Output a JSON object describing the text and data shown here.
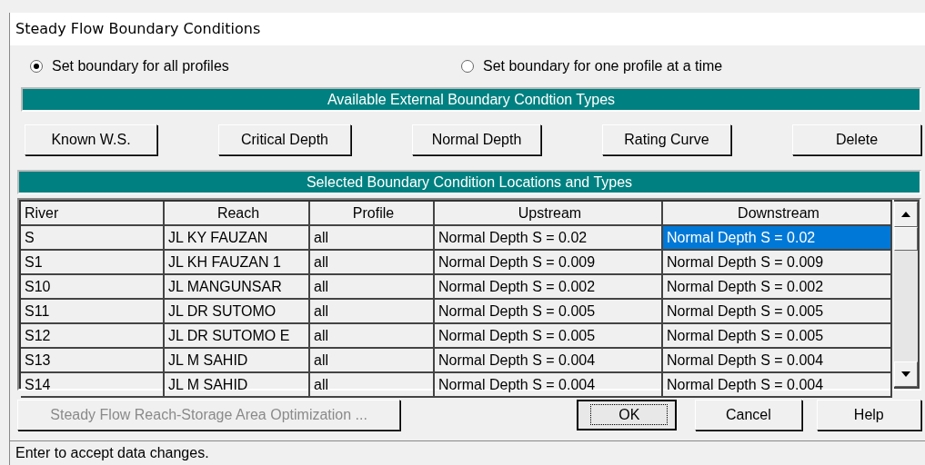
{
  "window": {
    "title": "Steady Flow Boundary Conditions"
  },
  "mode_options": [
    {
      "label": "Set boundary for all profiles",
      "selected": true
    },
    {
      "label": "Set boundary for one profile at a time",
      "selected": false
    }
  ],
  "types_header": "Available External Boundary Condtion Types",
  "type_buttons": [
    "Known W.S.",
    "Critical Depth",
    "Normal Depth",
    "Rating Curve",
    "Delete"
  ],
  "locations_header": "Selected Boundary Condition Locations and Types",
  "table": {
    "columns": [
      "River",
      "Reach",
      "Profile",
      "Upstream",
      "Downstream"
    ],
    "rows": [
      {
        "cells": [
          {
            "text": "S",
            "selected": false
          },
          {
            "text": "JL KY FAUZAN",
            "selected": false
          },
          {
            "text": "all",
            "selected": false
          },
          {
            "text": "Normal Depth S = 0.02",
            "selected": false
          },
          {
            "text": "Normal Depth S = 0.02",
            "selected": true
          }
        ]
      },
      {
        "cells": [
          {
            "text": "S1",
            "selected": false
          },
          {
            "text": "JL KH FAUZAN 1",
            "selected": false
          },
          {
            "text": "all",
            "selected": false
          },
          {
            "text": "Normal Depth S = 0.009",
            "selected": false
          },
          {
            "text": "Normal Depth S = 0.009",
            "selected": false
          }
        ]
      },
      {
        "cells": [
          {
            "text": "S10",
            "selected": false
          },
          {
            "text": "JL MANGUNSAR",
            "selected": false
          },
          {
            "text": "all",
            "selected": false
          },
          {
            "text": "Normal Depth S = 0.002",
            "selected": false
          },
          {
            "text": "Normal Depth S = 0.002",
            "selected": false
          }
        ]
      },
      {
        "cells": [
          {
            "text": "S11",
            "selected": false
          },
          {
            "text": "JL DR SUTOMO",
            "selected": false
          },
          {
            "text": "all",
            "selected": false
          },
          {
            "text": "Normal Depth S = 0.005",
            "selected": false
          },
          {
            "text": "Normal Depth S = 0.005",
            "selected": false
          }
        ]
      },
      {
        "cells": [
          {
            "text": "S12",
            "selected": false
          },
          {
            "text": "JL DR SUTOMO E",
            "selected": false
          },
          {
            "text": "all",
            "selected": false
          },
          {
            "text": "Normal Depth S = 0.005",
            "selected": false
          },
          {
            "text": "Normal Depth S = 0.005",
            "selected": false
          }
        ]
      },
      {
        "cells": [
          {
            "text": "S13",
            "selected": false
          },
          {
            "text": "JL M SAHID",
            "selected": false
          },
          {
            "text": "all",
            "selected": false
          },
          {
            "text": "Normal Depth S = 0.004",
            "selected": false
          },
          {
            "text": "Normal Depth S = 0.004",
            "selected": false
          }
        ]
      },
      {
        "cells": [
          {
            "text": "S14",
            "selected": false
          },
          {
            "text": "JL M SAHID",
            "selected": false
          },
          {
            "text": "all",
            "selected": false
          },
          {
            "text": "Normal Depth S = 0.004",
            "selected": false
          },
          {
            "text": "Normal Depth S = 0.004",
            "selected": false
          }
        ]
      }
    ]
  },
  "bottom_buttons": [
    {
      "label": "Steady Flow Reach-Storage Area Optimization ...",
      "disabled": true,
      "focused": false
    },
    {
      "label": "OK",
      "disabled": false,
      "focused": true
    },
    {
      "label": "Cancel",
      "disabled": false,
      "focused": false
    },
    {
      "label": "Help",
      "disabled": false,
      "focused": false
    }
  ],
  "status_bar": "Enter to accept data changes."
}
